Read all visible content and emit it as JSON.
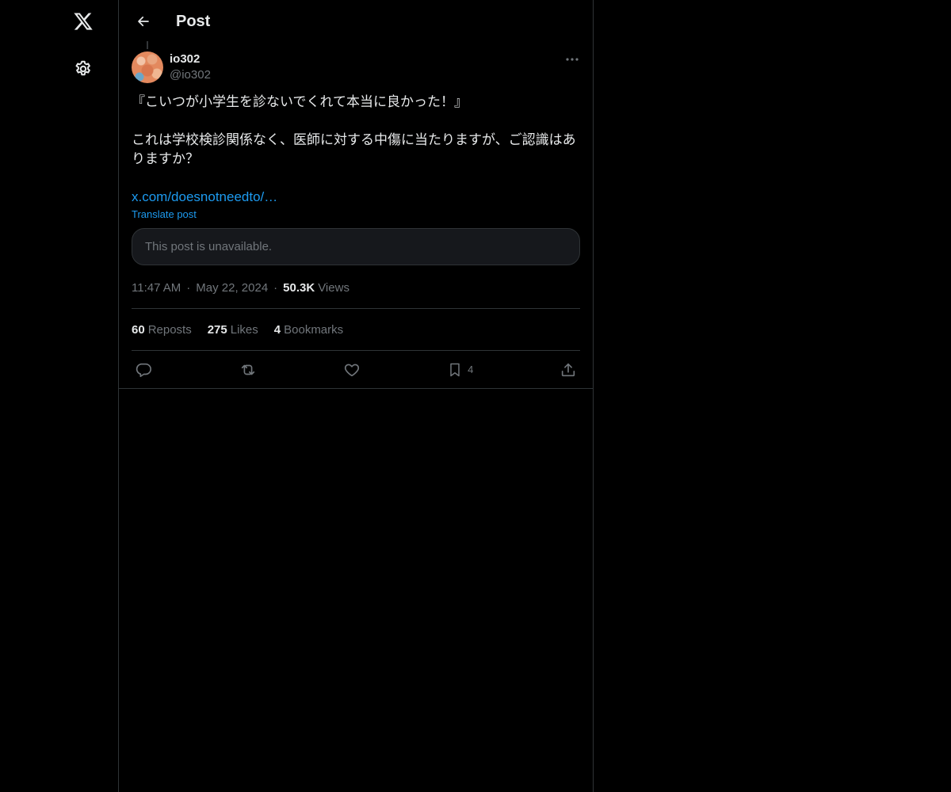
{
  "sidebar": {
    "logo_icon": "x-logo-icon",
    "settings_icon": "gear-icon"
  },
  "header": {
    "back_icon": "arrow-left-icon",
    "title": "Post"
  },
  "post": {
    "author": {
      "display_name": "io302",
      "handle": "@io302"
    },
    "more_icon": "more-horizontal-icon",
    "text": "『こいつが小学生を診ないでくれて本当に良かった！』\n\nこれは学校検診関係なく、医師に対する中傷に当たりますが、ご認識はありますか？",
    "link": "x.com/doesnotneedto/…",
    "translate_label": "Translate post",
    "quote_unavailable": "This post is unavailable.",
    "time": "11:47 AM",
    "date": "May 22, 2024",
    "views_count": "50.3K",
    "views_label": "Views",
    "separator": "·",
    "stats": {
      "reposts_count": "60",
      "reposts_label": "Reposts",
      "likes_count": "275",
      "likes_label": "Likes",
      "bookmarks_count": "4",
      "bookmarks_label": "Bookmarks"
    },
    "actions": {
      "reply_icon": "reply-icon",
      "repost_icon": "repost-icon",
      "like_icon": "heart-icon",
      "bookmark_icon": "bookmark-icon",
      "bookmark_count": "4",
      "share_icon": "share-icon"
    }
  },
  "colors": {
    "background": "#000000",
    "text_primary": "#e7e9ea",
    "text_secondary": "#71767b",
    "accent": "#1d9bf0",
    "border": "#2f3336",
    "quote_bg": "#16181c"
  }
}
